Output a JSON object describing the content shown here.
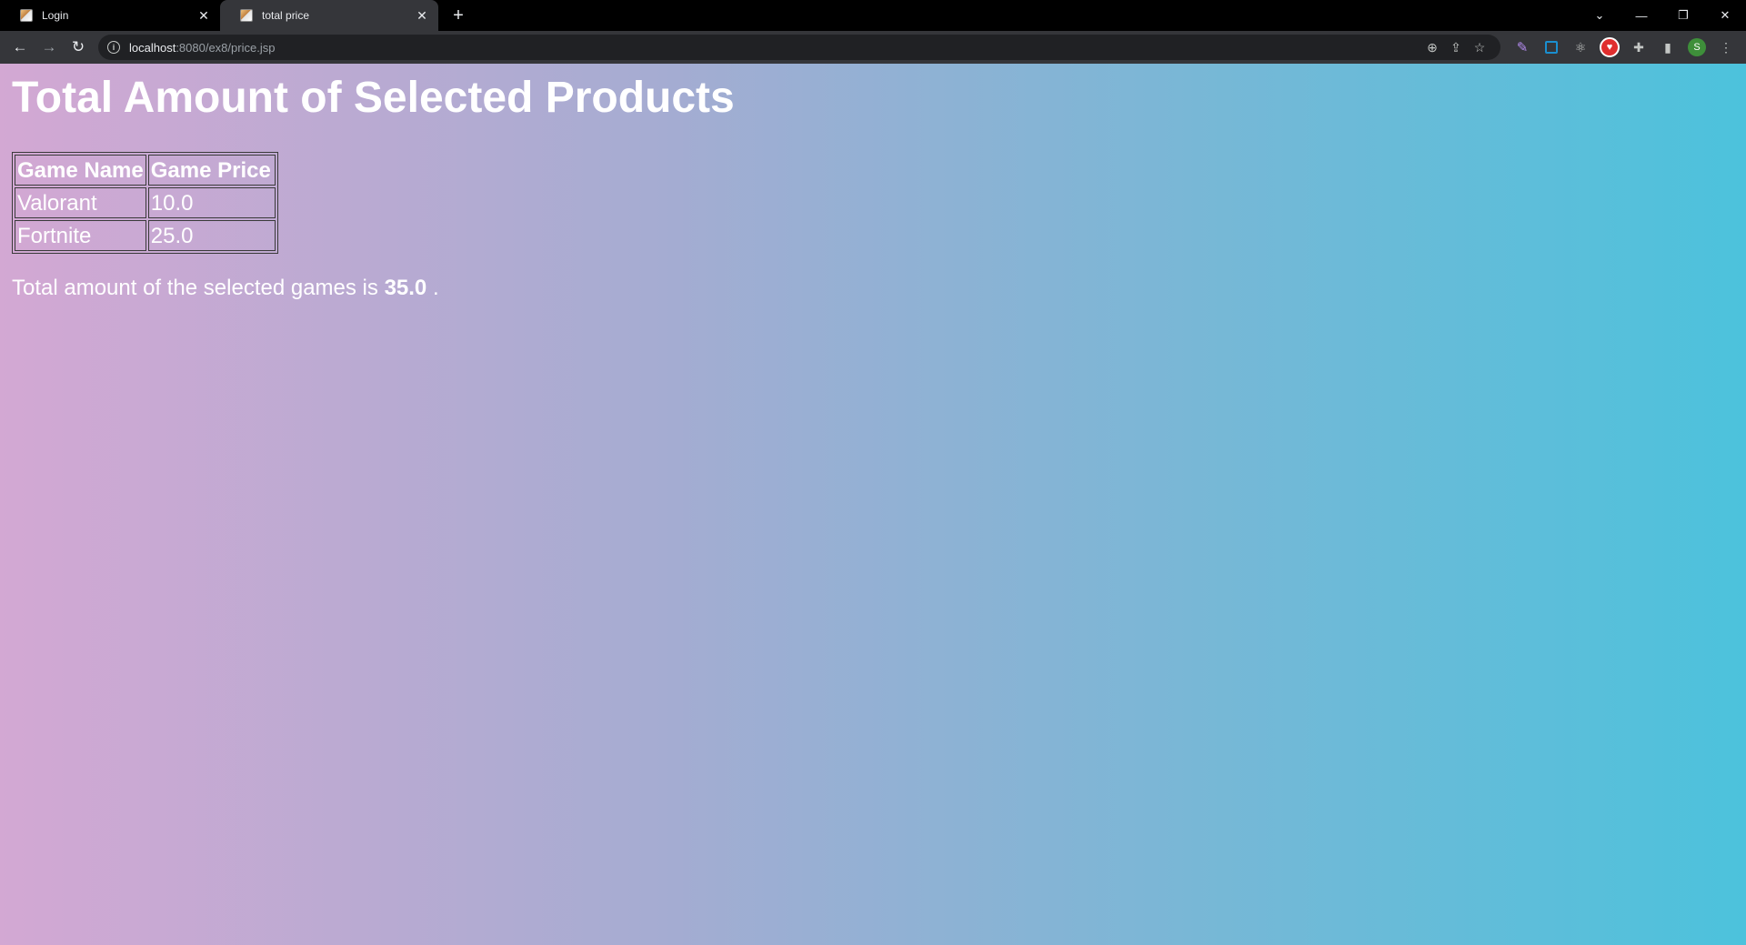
{
  "browser": {
    "tabs": [
      {
        "title": "Login",
        "active": false
      },
      {
        "title": "total price",
        "active": true
      }
    ],
    "address": {
      "host": "localhost",
      "path": ":8080/ex8/price.jsp"
    },
    "profile_initial": "S"
  },
  "page": {
    "heading": "Total Amount of Selected Products",
    "table": {
      "headers": [
        "Game Name",
        "Game Price"
      ],
      "rows": [
        {
          "name": "Valorant",
          "price": "10.0"
        },
        {
          "name": "Fortnite",
          "price": "25.0"
        }
      ]
    },
    "total": {
      "prefix": "Total amount of the selected games is",
      "amount": "35.0",
      "suffix": "."
    }
  },
  "colors": {
    "gradient_start": "#d3a8d3",
    "gradient_end": "#4cc2dc",
    "text": "#ffffff"
  }
}
